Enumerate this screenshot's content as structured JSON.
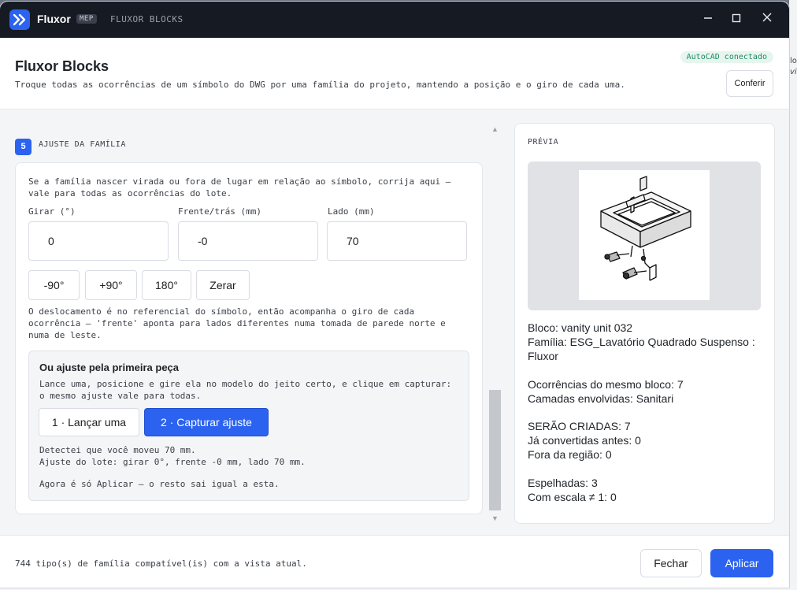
{
  "window": {
    "app_name": "Fluxor",
    "badge": "MEP",
    "module": "FLUXOR BLOCKS",
    "controls": [
      "minimize-icon",
      "maximize-icon",
      "close-icon"
    ]
  },
  "header": {
    "title": "Fluxor Blocks",
    "subtitle": "Troque todas as ocorrências de um símbolo do DWG por uma família do projeto, mantendo a posição e o giro de cada uma.",
    "status": "AutoCAD conectado",
    "check_button": "Conferir"
  },
  "step": {
    "number": "5",
    "title": "AJUSTE DA FAMÍLIA",
    "description": "Se a família nascer virada ou fora de lugar em relação ao símbolo, corrija aqui — vale para todas as ocorrências do lote.",
    "fields": [
      {
        "label": "Girar (°)",
        "value": "0"
      },
      {
        "label": "Frente/trás (mm)",
        "value": "-0"
      },
      {
        "label": "Lado (mm)",
        "value": "70"
      }
    ],
    "rotate_buttons": [
      "-90°",
      "+90°",
      "180°",
      "Zerar"
    ],
    "offset_note": "O deslocamento é no referencial do símbolo, então acompanha o giro de cada ocorrência — 'frente' aponta para lados diferentes numa tomada de parede norte e numa de leste.",
    "capture": {
      "title": "Ou ajuste pela primeira peça",
      "description": "Lance uma, posicione e gire ela no modelo do jeito certo, e clique em capturar: o mesmo ajuste vale para todas.",
      "launch_button": "1 · Lançar uma",
      "capture_button": "2 · Capturar ajuste",
      "result_line1": "Detectei que você moveu 70 mm.",
      "result_line2": "Ajuste do lote: girar 0°, frente -0 mm, lado 70 mm.",
      "result_line3": "Agora é só Aplicar — o resto sai igual a esta."
    }
  },
  "preview": {
    "title": "PRÉVIA",
    "block": "Bloco: vanity unit 032",
    "family": "Família: ESG_Lavatório Quadrado Suspenso : Fluxor",
    "occurrences": "Ocorrências do mesmo bloco: 7",
    "layers": "Camadas envolvidas: Sanitari",
    "to_create": "SERÃO CRIADAS: 7",
    "already_converted": "Já convertidas antes: 0",
    "outside_region": "Fora da região: 0",
    "mirrored": "Espelhadas: 3",
    "scale": "Com escala ≠ 1: 0"
  },
  "footer": {
    "status": "744 tipo(s) de família compatível(is) com a vista atual.",
    "close_button": "Fechar",
    "apply_button": "Aplicar"
  },
  "colors": {
    "accent": "#2b63f0",
    "titlebar": "#161a22",
    "status_green": "#1d8a61"
  }
}
